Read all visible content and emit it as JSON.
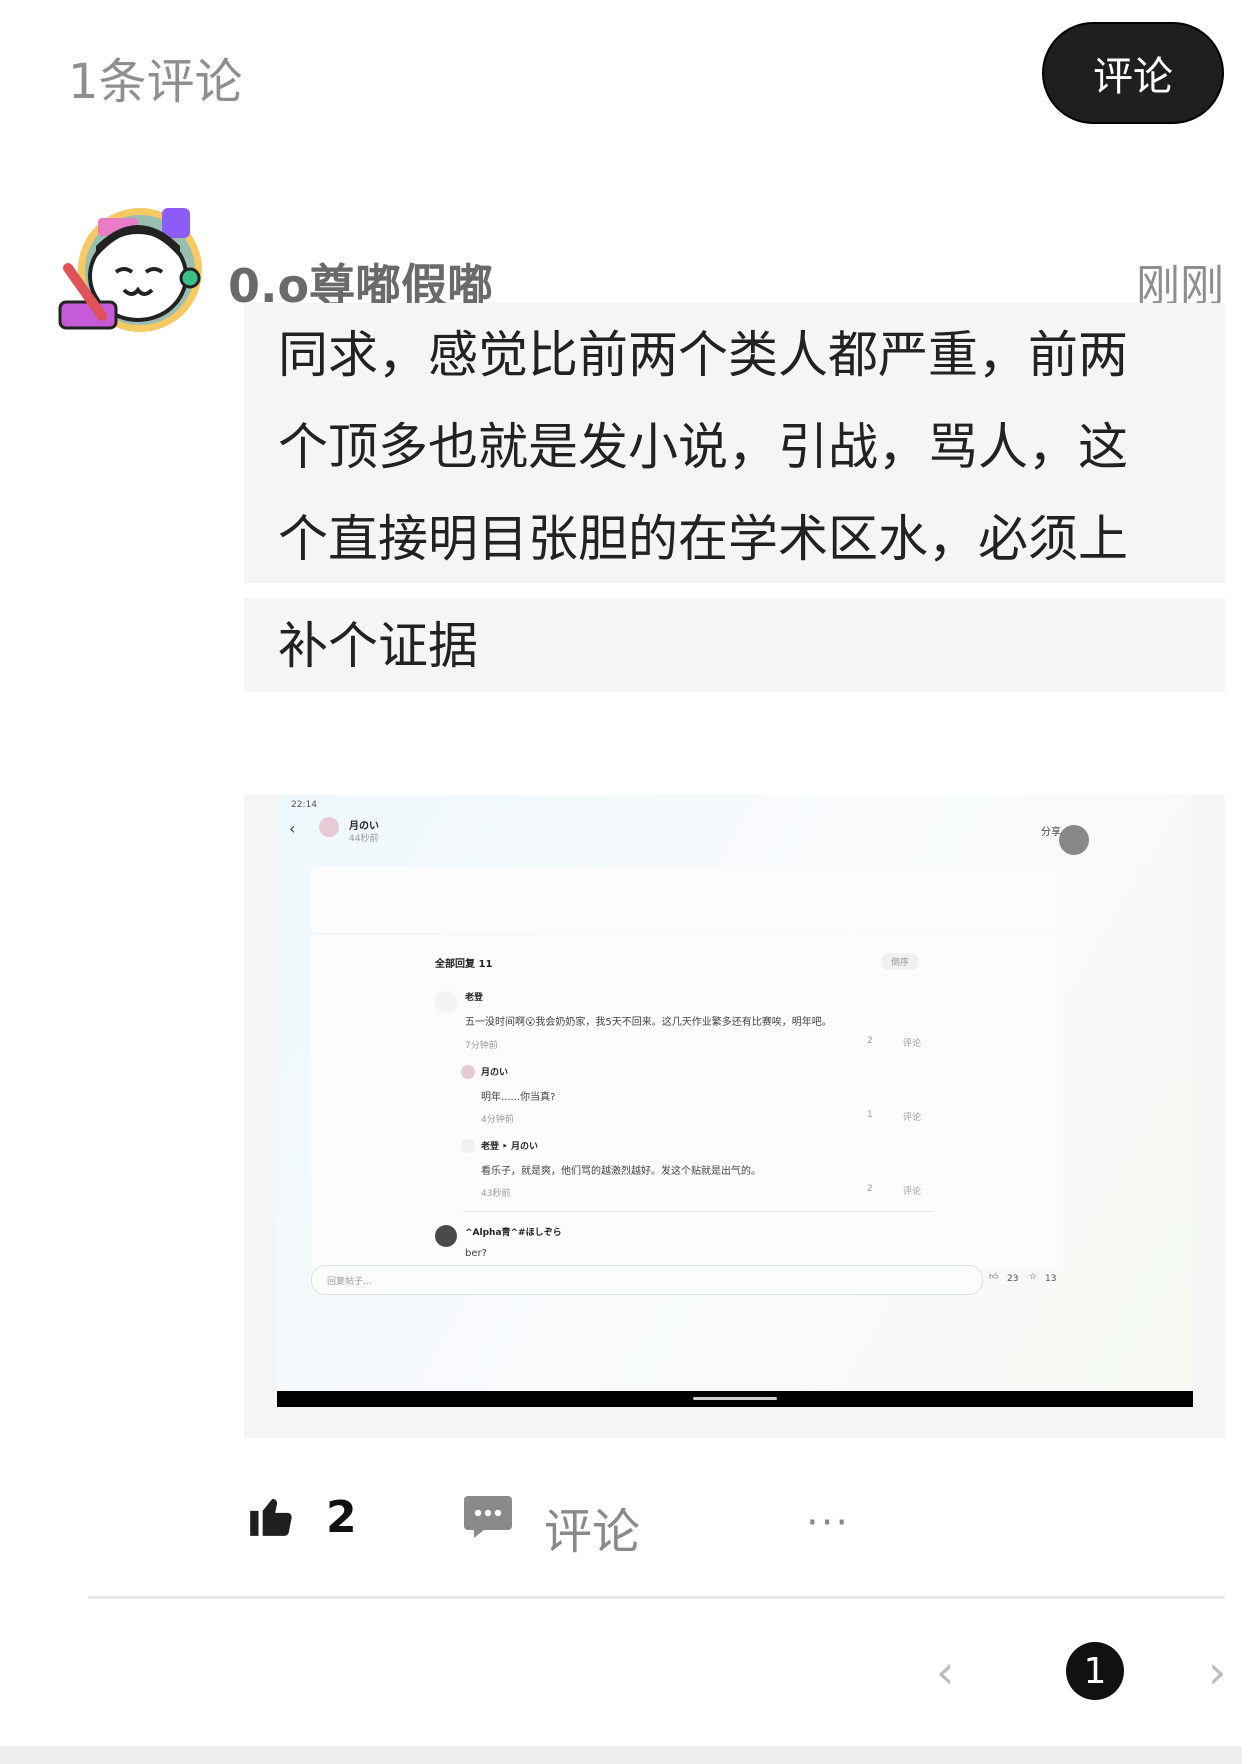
{
  "header": {
    "comment_count": "1条评论",
    "comment_button": "评论"
  },
  "comment": {
    "author": "0.o尊嘟假嘟",
    "time": "刚刚",
    "lines": [
      "同求，感觉比前两个类人都严重，前两",
      "个顶多也就是发小说，引战，骂人，这",
      "个直接明目张胆的在学术区水，必须上",
      "补个证据"
    ],
    "likes": "2",
    "reply_label": "评论",
    "more": "···"
  },
  "screenshot": {
    "status_time": "22:14",
    "user": "月のい",
    "user_time": "44秒前",
    "share": "分享",
    "all_replies": "全部回复 11",
    "sort": "倒序",
    "replies": [
      {
        "name": "老登",
        "text": "五一没时间啊😮我会奶奶家，我5天不回来。这几天作业繁多还有比赛唉，明年吧。",
        "time": "7分钟前",
        "likes": "2",
        "action": "评论"
      },
      {
        "name": "月のい",
        "text": "明年......你当真?",
        "time": "4分钟前",
        "likes": "1",
        "action": "评论"
      },
      {
        "name": "老登 ‣ 月のい",
        "text": "看乐子，就是爽，他们骂的越激烈越好。发这个贴就是出气的。",
        "time": "43秒前",
        "likes": "2",
        "action": "评论"
      },
      {
        "name": "^Alpha青^#ほしぞら",
        "text": "ber?"
      }
    ],
    "input_placeholder": "回复帖子...",
    "like_total": "23",
    "star_total": "13"
  },
  "pagination": {
    "prev": "‹",
    "current": "1",
    "next": "›"
  },
  "colors": {
    "dark": "#1f1f1f",
    "muted": "#8f8f8f",
    "bubble": "#f5f5f5"
  }
}
